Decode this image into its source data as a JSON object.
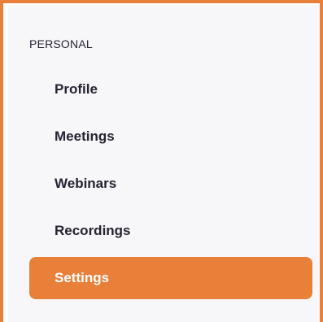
{
  "sidebar": {
    "section_label": "PERSONAL",
    "items": [
      {
        "label": "Profile",
        "active": false
      },
      {
        "label": "Meetings",
        "active": false
      },
      {
        "label": "Webinars",
        "active": false
      },
      {
        "label": "Recordings",
        "active": false
      },
      {
        "label": "Settings",
        "active": true
      }
    ]
  },
  "colors": {
    "accent": "#e8803a",
    "panel_background": "#f7f7f9",
    "text": "#232333"
  }
}
